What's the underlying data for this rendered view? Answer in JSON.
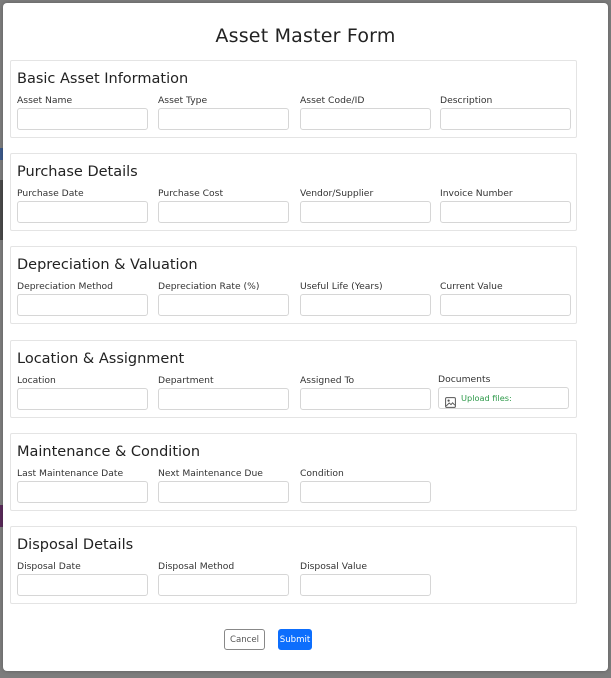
{
  "form": {
    "title": "Asset Master Form"
  },
  "sections": [
    {
      "title": "Basic Asset Information",
      "fields": [
        "Asset Name",
        "Asset Type",
        "Asset Code/ID",
        "Description"
      ]
    },
    {
      "title": "Purchase Details",
      "fields": [
        "Purchase Date",
        "Purchase Cost",
        "Vendor/Supplier",
        "Invoice Number"
      ]
    },
    {
      "title": "Depreciation & Valuation",
      "fields": [
        "Depreciation Method",
        "Depreciation Rate (%)",
        "Useful Life (Years)",
        "Current Value"
      ]
    },
    {
      "title": "Location & Assignment",
      "fields": [
        "Location",
        "Department",
        "Assigned To",
        "Documents"
      ]
    },
    {
      "title": "Maintenance & Condition",
      "fields": [
        "Last Maintenance Date",
        "Next Maintenance Due",
        "Condition"
      ]
    },
    {
      "title": "Disposal Details",
      "fields": [
        "Disposal Date",
        "Disposal Method",
        "Disposal Value"
      ]
    }
  ],
  "upload": {
    "label": "Upload files:",
    "icon": "image-icon"
  },
  "actions": {
    "cancel": "Cancel",
    "submit": "Submit"
  },
  "colors": {
    "primary": "#0d6efd",
    "upload_text": "#2e9a4a"
  }
}
